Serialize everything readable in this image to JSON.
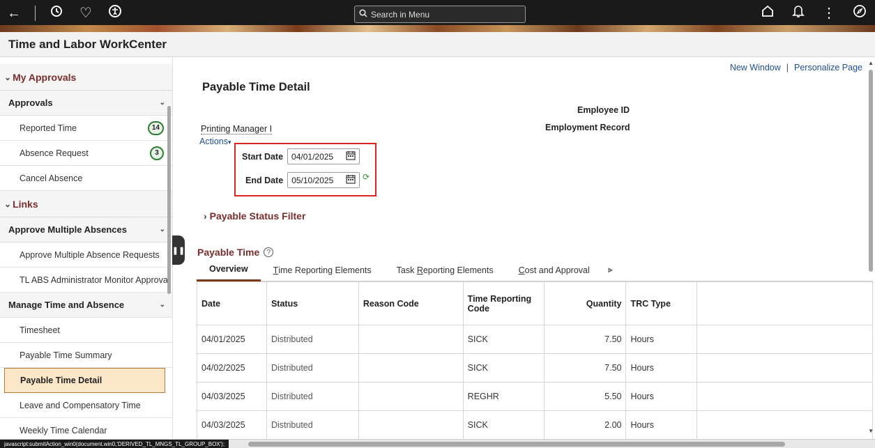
{
  "topbar": {
    "search_placeholder": "Search in Menu"
  },
  "title": "Time and Labor WorkCenter",
  "sidebar": {
    "my_approvals": "My Approvals",
    "approvals_group": "Approvals",
    "reported_time": "Reported Time",
    "reported_time_count": "14",
    "absence_request": "Absence Request",
    "absence_request_count": "3",
    "cancel_absence": "Cancel Absence",
    "links": "Links",
    "approve_multiple_group": "Approve Multiple Absences",
    "approve_multiple_requests": "Approve Multiple Absence Requests",
    "tl_abs_monitor": "TL ABS Administrator Monitor Approva",
    "manage_group": "Manage Time and Absence",
    "timesheet": "Timesheet",
    "payable_time_summary": "Payable Time Summary",
    "payable_time_detail": "Payable Time Detail",
    "leave_comp_time": "Leave and Compensatory Time",
    "weekly_time_calendar": "Weekly Time Calendar"
  },
  "main": {
    "new_window": "New Window",
    "personalize_page": "Personalize Page",
    "page_title": "Payable Time Detail",
    "employee_id_label": "Employee ID",
    "employment_record_label": "Employment Record",
    "employee_name": "Printing Manager I",
    "actions": "Actions",
    "start_date_label": "Start Date",
    "start_date_value": "04/01/2025",
    "end_date_label": "End Date",
    "end_date_value": "05/10/2025",
    "status_filter": "Payable Status Filter",
    "payable_time_header": "Payable Time"
  },
  "tabs": {
    "overview": "Overview",
    "tre_pre": "",
    "tre_u": "T",
    "tre_post": "ime Reporting Elements",
    "task_pre": "Task ",
    "task_u": "R",
    "task_post": "eporting Elements",
    "cost_pre": "",
    "cost_u": "C",
    "cost_post": "ost and Approval"
  },
  "table": {
    "headers": {
      "date": "Date",
      "status": "Status",
      "reason_code": "Reason Code",
      "trc": "Time Reporting Code",
      "quantity": "Quantity",
      "trc_type": "TRC Type"
    },
    "rows": [
      {
        "date": "04/01/2025",
        "status": "Distributed",
        "reason": "",
        "trc": "SICK",
        "quantity": "7.50",
        "type": "Hours"
      },
      {
        "date": "04/02/2025",
        "status": "Distributed",
        "reason": "",
        "trc": "SICK",
        "quantity": "7.50",
        "type": "Hours"
      },
      {
        "date": "04/03/2025",
        "status": "Distributed",
        "reason": "",
        "trc": "REGHR",
        "quantity": "5.50",
        "type": "Hours"
      },
      {
        "date": "04/03/2025",
        "status": "Distributed",
        "reason": "",
        "trc": "SICK",
        "quantity": "2.00",
        "type": "Hours"
      }
    ]
  },
  "statusbar": {
    "text": "javascript:submitAction_win0(document.win0,'DERIVED_TL_MNGS_TL_GROUP_BOX');"
  }
}
